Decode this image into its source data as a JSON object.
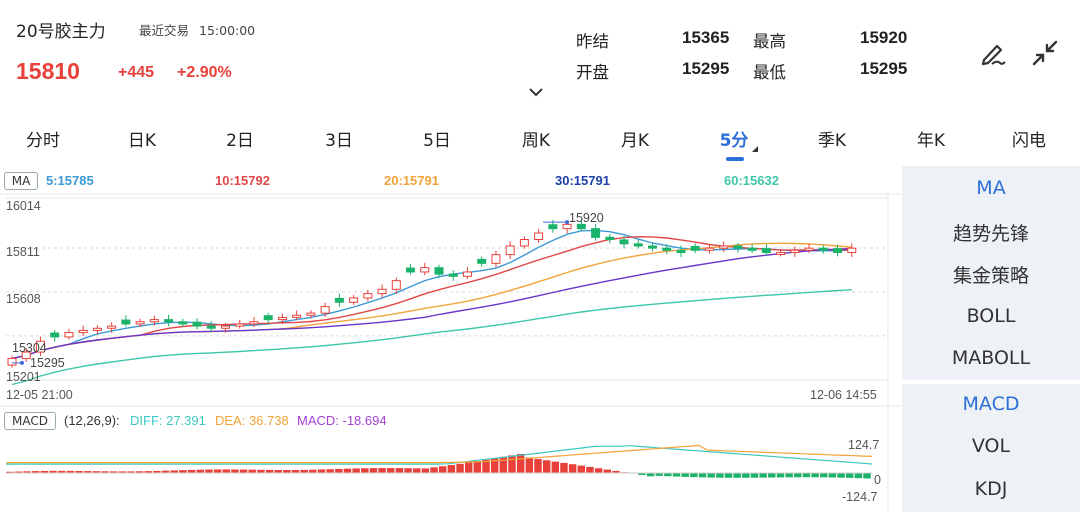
{
  "header": {
    "title": "20号胶主力",
    "recent_label": "最近交易",
    "recent_time": "15:00:00",
    "price": "15810",
    "change": "+445",
    "change_pct": "+2.90%",
    "stats": [
      {
        "label": "昨结",
        "value": "15365"
      },
      {
        "label": "开盘",
        "value": "15295"
      },
      {
        "label": "最高",
        "value": "15920"
      },
      {
        "label": "最低",
        "value": "15295"
      }
    ]
  },
  "tabs": [
    "分时",
    "日K",
    "2日",
    "3日",
    "5日",
    "周K",
    "月K",
    "5分",
    "季K",
    "年K",
    "闪电"
  ],
  "active_tab": "5分",
  "ma_panel": {
    "chip": "MA",
    "values": [
      {
        "label": "5:15785",
        "color": "#3d9ad6"
      },
      {
        "label": "10:15792",
        "color": "#e04848"
      },
      {
        "label": "20:15791",
        "color": "#f2a33a"
      },
      {
        "label": "30:15791",
        "color": "#1c3fa8"
      },
      {
        "label": "60:15632",
        "color": "#3ec7a8"
      }
    ],
    "y_labels": [
      "16014",
      "15811",
      "15608",
      "15201"
    ],
    "high_marker": "15920",
    "low_marker": "15295",
    "low_partial": "15304"
  },
  "macd_panel": {
    "chip": "MACD",
    "params": "(12,26,9):",
    "diff": "DIFF: 27.391",
    "dea": "DEA: 36.738",
    "macd": "MACD: -18.694",
    "y_top": "124.7",
    "y_zero": "0",
    "y_bottom": "-124.7"
  },
  "time_axis": {
    "start": "12-05 21:00",
    "end": "12-06 14:55"
  },
  "side_panel": {
    "top_items": [
      "MA",
      "趋势先锋",
      "集金策略",
      "BOLL",
      "MABOLL"
    ],
    "bottom_items": [
      "MACD",
      "VOL",
      "KDJ"
    ],
    "active_top": "MA",
    "active_bottom": "MACD"
  },
  "colors": {
    "up": "#e8413b",
    "down": "#1bb36a",
    "accent": "#2d6fd8",
    "ma5": "#3d9ad6",
    "ma10": "#e04848",
    "ma20": "#f2a33a",
    "ma30": "#6a36c9",
    "ma60": "#3ec7a8",
    "diff": "#3ec7c0",
    "dea": "#f2a33a",
    "macd": "#a63fd4"
  },
  "chart_data": {
    "type": "candlestick",
    "interval": "5分",
    "y_range": [
      15201,
      16014
    ],
    "x_range": [
      "12-05 21:00",
      "12-06 14:55"
    ],
    "visible_high": 15920,
    "visible_low": 15295,
    "ma_latest": {
      "MA5": 15785,
      "MA10": 15792,
      "MA20": 15791,
      "MA30": 15791,
      "MA60": 15632
    },
    "close_path": [
      15300,
      15330,
      15380,
      15400,
      15420,
      15430,
      15440,
      15450,
      15460,
      15470,
      15480,
      15470,
      15460,
      15450,
      15440,
      15450,
      15460,
      15470,
      15480,
      15490,
      15500,
      15510,
      15540,
      15560,
      15580,
      15600,
      15620,
      15660,
      15700,
      15720,
      15690,
      15680,
      15700,
      15740,
      15780,
      15820,
      15850,
      15880,
      15900,
      15920,
      15900,
      15860,
      15850,
      15830,
      15820,
      15810,
      15800,
      15790,
      15800,
      15810,
      15820,
      15810,
      15800,
      15790,
      15790,
      15800,
      15810,
      15800,
      15790,
      15810
    ],
    "macd_latest": {
      "DIFF": 27.391,
      "DEA": 36.738,
      "MACD": -18.694
    },
    "macd_range": [
      -124.7,
      124.7
    ]
  }
}
